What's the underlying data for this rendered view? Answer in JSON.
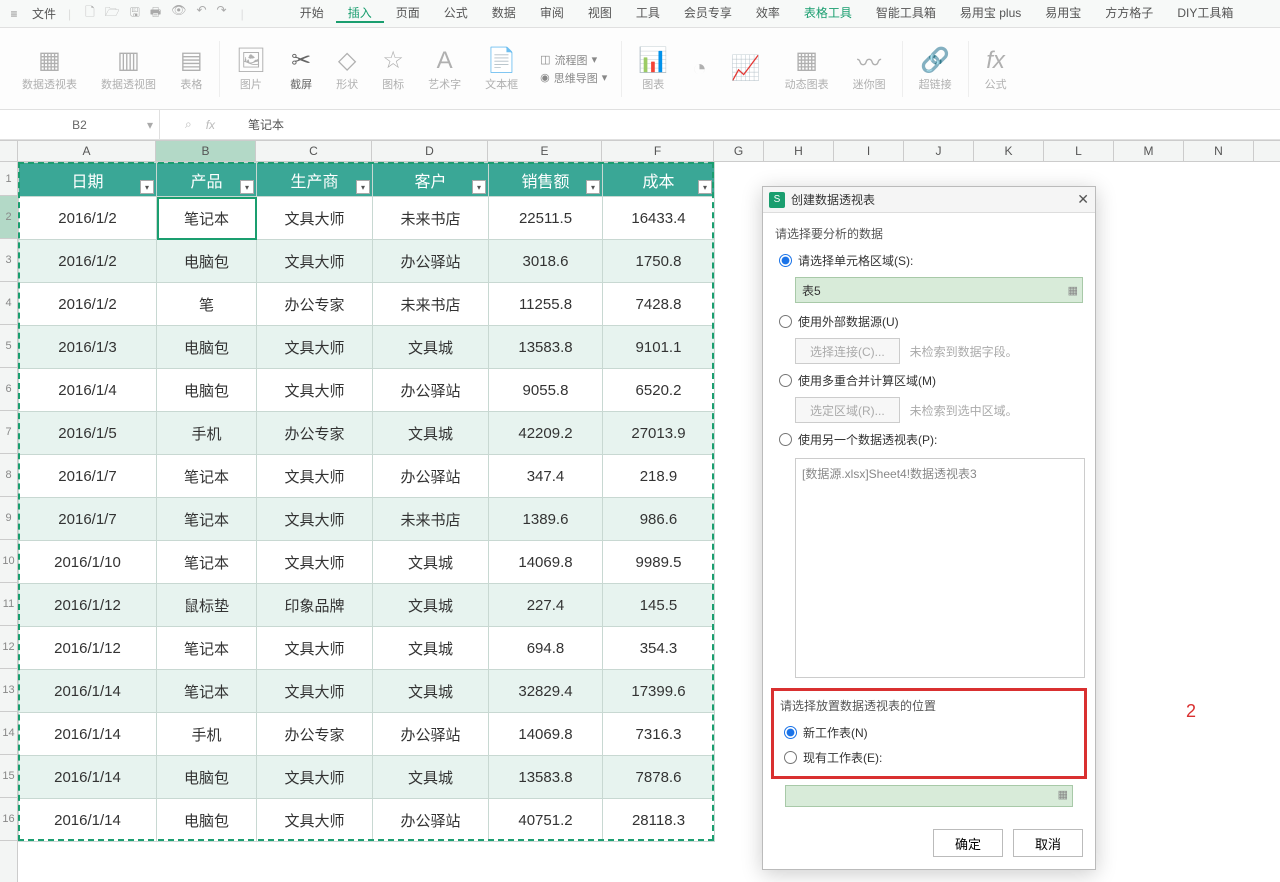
{
  "menubar": {
    "file": "文件",
    "tabs": [
      "开始",
      "插入",
      "页面",
      "公式",
      "数据",
      "审阅",
      "视图",
      "工具",
      "会员专享",
      "效率",
      "表格工具",
      "智能工具箱",
      "易用宝 plus",
      "易用宝",
      "方方格子",
      "DIY工具箱"
    ],
    "active_tab_index": 1,
    "context_tab_index": 10
  },
  "ribbon": {
    "pivot_table": "数据透视表",
    "pivot_chart": "数据透视图",
    "table": "表格",
    "picture": "图片",
    "screenshot": "截屏",
    "shapes": "形状",
    "icon": "图标",
    "wordart": "艺术字",
    "textbox": "文本框",
    "flowchart": "流程图",
    "mindmap": "思维导图",
    "chart": "图表",
    "dynamic_chart": "动态图表",
    "sparkline": "迷你图",
    "hyperlink": "超链接",
    "formula": "公式"
  },
  "namebox": "B2",
  "fxvalue": "笔记本",
  "columns": [
    "A",
    "B",
    "C",
    "D",
    "E",
    "F",
    "G",
    "H",
    "I",
    "J",
    "K",
    "L",
    "M",
    "N"
  ],
  "headers": [
    "日期",
    "产品",
    "生产商",
    "客户",
    "销售额",
    "成本"
  ],
  "rows": [
    {
      "n": "2",
      "d": "2016/1/2",
      "p": "笔记本",
      "m": "文具大师",
      "c": "未来书店",
      "s": "22511.5",
      "cost": "16433.4"
    },
    {
      "n": "3",
      "d": "2016/1/2",
      "p": "电脑包",
      "m": "文具大师",
      "c": "办公驿站",
      "s": "3018.6",
      "cost": "1750.8"
    },
    {
      "n": "4",
      "d": "2016/1/2",
      "p": "笔",
      "m": "办公专家",
      "c": "未来书店",
      "s": "11255.8",
      "cost": "7428.8"
    },
    {
      "n": "5",
      "d": "2016/1/3",
      "p": "电脑包",
      "m": "文具大师",
      "c": "文具城",
      "s": "13583.8",
      "cost": "9101.1"
    },
    {
      "n": "6",
      "d": "2016/1/4",
      "p": "电脑包",
      "m": "文具大师",
      "c": "办公驿站",
      "s": "9055.8",
      "cost": "6520.2"
    },
    {
      "n": "7",
      "d": "2016/1/5",
      "p": "手机",
      "m": "办公专家",
      "c": "文具城",
      "s": "42209.2",
      "cost": "27013.9"
    },
    {
      "n": "8",
      "d": "2016/1/7",
      "p": "笔记本",
      "m": "文具大师",
      "c": "办公驿站",
      "s": "347.4",
      "cost": "218.9"
    },
    {
      "n": "9",
      "d": "2016/1/7",
      "p": "笔记本",
      "m": "文具大师",
      "c": "未来书店",
      "s": "1389.6",
      "cost": "986.6"
    },
    {
      "n": "10",
      "d": "2016/1/10",
      "p": "笔记本",
      "m": "文具大师",
      "c": "文具城",
      "s": "14069.8",
      "cost": "9989.5"
    },
    {
      "n": "11",
      "d": "2016/1/12",
      "p": "鼠标垫",
      "m": "印象品牌",
      "c": "文具城",
      "s": "227.4",
      "cost": "145.5"
    },
    {
      "n": "12",
      "d": "2016/1/12",
      "p": "笔记本",
      "m": "文具大师",
      "c": "文具城",
      "s": "694.8",
      "cost": "354.3"
    },
    {
      "n": "13",
      "d": "2016/1/14",
      "p": "笔记本",
      "m": "文具大师",
      "c": "文具城",
      "s": "32829.4",
      "cost": "17399.6"
    },
    {
      "n": "14",
      "d": "2016/1/14",
      "p": "手机",
      "m": "办公专家",
      "c": "办公驿站",
      "s": "14069.8",
      "cost": "7316.3"
    },
    {
      "n": "15",
      "d": "2016/1/14",
      "p": "电脑包",
      "m": "文具大师",
      "c": "文具城",
      "s": "13583.8",
      "cost": "7878.6"
    },
    {
      "n": "16",
      "d": "2016/1/14",
      "p": "电脑包",
      "m": "文具大师",
      "c": "办公驿站",
      "s": "40751.2",
      "cost": "28118.3"
    }
  ],
  "dialog": {
    "title": "创建数据透视表",
    "section1": "请选择要分析的数据",
    "opt_range": "请选择单元格区域(S):",
    "range_value": "表5",
    "opt_external": "使用外部数据源(U)",
    "btn_conn": "选择连接(C)...",
    "hint_conn": "未检索到数据字段。",
    "opt_multi": "使用多重合并计算区域(M)",
    "btn_area": "选定区域(R)...",
    "hint_area": "未检索到选中区域。",
    "opt_another": "使用另一个数据透视表(P):",
    "list_item": "[数据源.xlsx]Sheet4!数据透视表3",
    "section2": "请选择放置数据透视表的位置",
    "opt_newsheet": "新工作表(N)",
    "opt_existing": "现有工作表(E):",
    "annotation": "2",
    "ok": "确定",
    "cancel": "取消"
  }
}
